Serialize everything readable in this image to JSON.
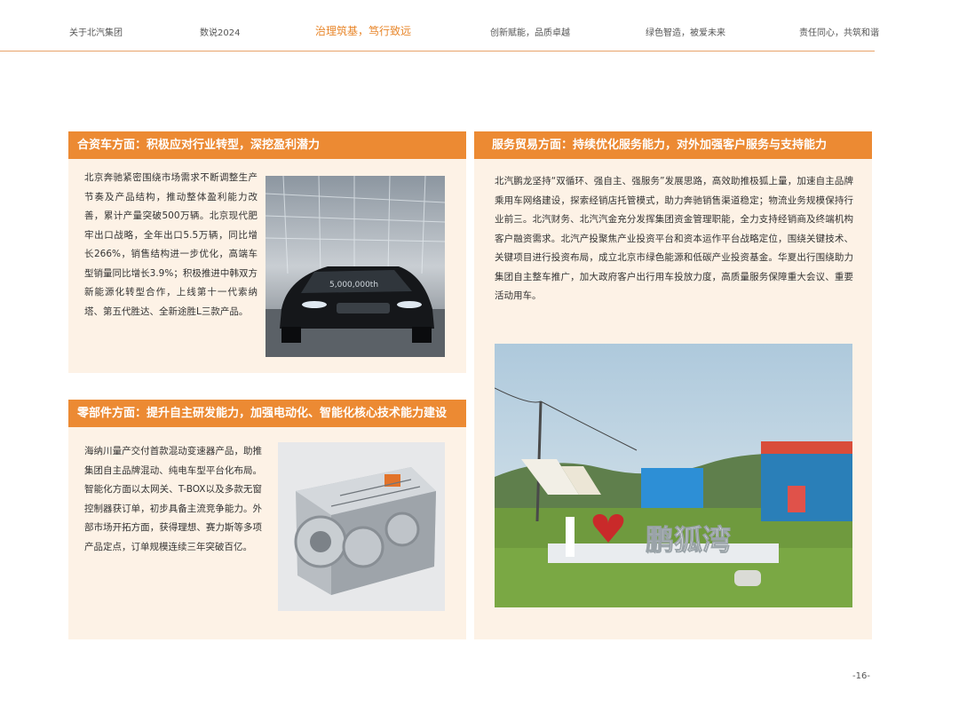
{
  "nav": {
    "items": [
      "关于北汽集团",
      "数说2024",
      "治理筑基，笃行致远",
      "创新赋能，品质卓越",
      "绿色智造，被爱未来",
      "责任同心，共筑和谐"
    ]
  },
  "sections": {
    "jv": {
      "title": "合资车方面：积极应对行业转型，深挖盈利潜力",
      "body": "北京奔驰紧密围绕市场需求不断调整生产节奏及产品结构，推动整体盈利能力改善，累计产量突破500万辆。北京现代肥牢出口战略，全年出口5.5万辆，同比增长266%，销售结构进一步优化，高端车型销量同比增长3.9%；积极推进中韩双方新能源化转型合作，上线第十一代索纳塔、第五代胜达、全新途胜L三款产品。"
    },
    "parts": {
      "title": "零部件方面：提升自主研发能力，加强电动化、智能化核心技术能力建设",
      "body": "海纳川量产交付首款混动变速器产品，助推集团自主品牌混动、纯电车型平台化布局。智能化方面以太网关、T-BOX以及多款无窗控制器获订单，初步具备主流竞争能力。外部市场开拓方面，获得理想、赛力斯等多项产品定点，订单规模连续三年突破百亿。"
    },
    "service": {
      "title": "服务贸易方面：持续优化服务能力，对外加强客户服务与支持能力",
      "body": "北汽鹏龙坚持“双循环、强自主、强服务”发展思路，高效助推极狐上量，加速自主品牌乘用车网络建设，探索经销店托管模式，助力奔驰销售渠道稳定；物流业务规模保持行业前三。北汽财务、北汽汽金充分发挥集团资金管理职能，全力支持经销商及终端机构客户融资需求。北汽产投聚焦产业投资平台和资本运作平台战略定位，围绕关键技术、关键项目进行投资布局，成立北京市绿色能源和低碳产业投资基金。华夏出行围绕助力集团自主整车推广，加大政府客户出行用车投放力度，高质量服务保障重大会议、重要活动用车。"
    }
  },
  "photos": {
    "car_badge": "5,000,000th",
    "sign_text": "鹏狐湾"
  },
  "page_number": "-16-",
  "colors": {
    "accent": "#ec8a33",
    "card_bg": "#fdf2e6",
    "nav_active": "#e8862a"
  }
}
